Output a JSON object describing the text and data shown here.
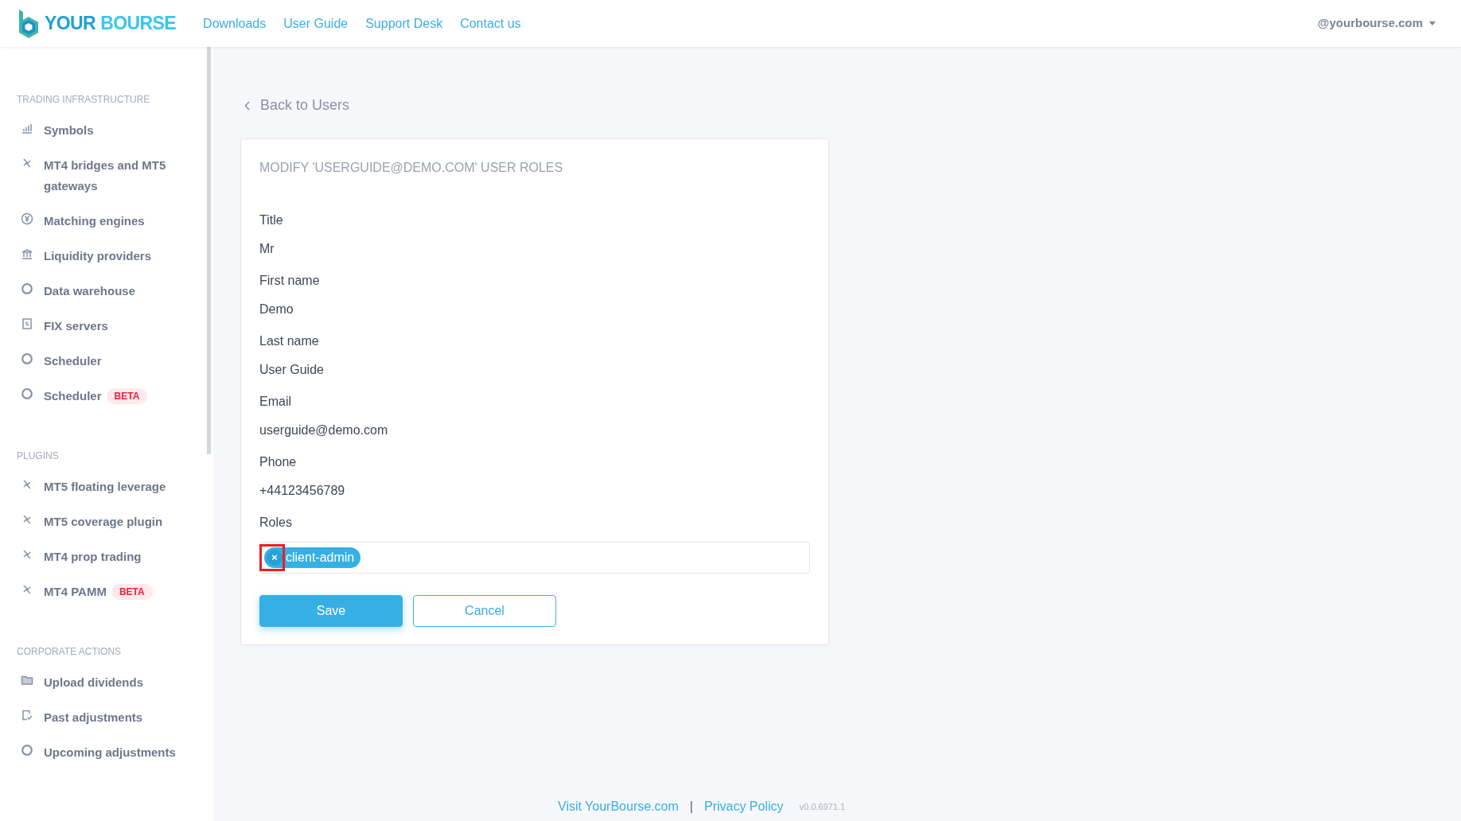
{
  "header": {
    "logo": {
      "word_1": "YOUR",
      "word_2": "BOURSE"
    },
    "nav": [
      "Downloads",
      "User Guide",
      "Support Desk",
      "Contact us"
    ],
    "account": "@yourbourse.com"
  },
  "sidebar": {
    "sections": [
      {
        "title": "TRADING INFRASTRUCTURE",
        "items": [
          {
            "label": "Symbols"
          },
          {
            "label": "MT4 bridges and MT5 gateways"
          },
          {
            "label": "Matching engines"
          },
          {
            "label": "Liquidity providers"
          },
          {
            "label": "Data warehouse"
          },
          {
            "label": "FIX servers"
          },
          {
            "label": "Scheduler"
          },
          {
            "label": "Scheduler",
            "badge": "BETA"
          }
        ]
      },
      {
        "title": "PLUGINS",
        "items": [
          {
            "label": "MT5 floating leverage"
          },
          {
            "label": "MT5 coverage plugin"
          },
          {
            "label": "MT4 prop trading"
          },
          {
            "label": "MT4 PAMM",
            "badge": "BETA"
          }
        ]
      },
      {
        "title": "CORPORATE ACTIONS",
        "items": [
          {
            "label": "Upload dividends"
          },
          {
            "label": "Past adjustments"
          },
          {
            "label": "Upcoming adjustments"
          }
        ]
      }
    ]
  },
  "back_link": "Back to Users",
  "form": {
    "title": "MODIFY 'USERGUIDE@DEMO.COM' USER ROLES",
    "fields": [
      {
        "label": "Title",
        "value": "Mr"
      },
      {
        "label": "First name",
        "value": "Demo"
      },
      {
        "label": "Last name",
        "value": "User Guide"
      },
      {
        "label": "Email",
        "value": "userguide@demo.com"
      },
      {
        "label": "Phone",
        "value": "+44123456789"
      }
    ],
    "roles": {
      "label": "Roles",
      "tags": [
        {
          "text": "client-admin",
          "remove": "×",
          "highlighted": true
        }
      ]
    },
    "buttons": [
      {
        "label": "Save",
        "kind": "primary"
      },
      {
        "label": "Cancel",
        "kind": "secondary"
      }
    ]
  },
  "footer": {
    "links": [
      "Visit YourBourse.com",
      "Privacy Policy"
    ],
    "separator": "|",
    "version": "v0.0.6971.1"
  }
}
